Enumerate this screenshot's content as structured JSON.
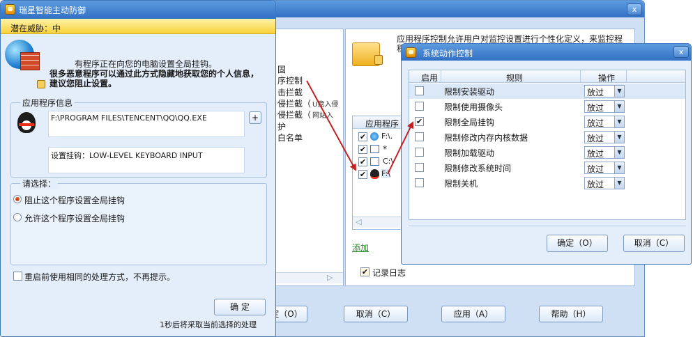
{
  "alert": {
    "title": "瑞星智能主动防御",
    "threat": "潜在威胁：中",
    "message1": "有程序正在向您的电脑设置全局挂钩。",
    "message2": "很多恶意程序可以通过此方式隐藏地获取您的个人信息，建议您阻止设置。",
    "info_label": "应用程序信息",
    "program_path": "F:\\PROGRAM FILES\\TENCENT\\QQ\\QQ.EXE",
    "plus": "+",
    "hook_info": "设置挂钩：LOW-LEVEL KEYBOARD INPUT",
    "choose_label": "请选择：",
    "options": [
      "阻止这个程序设置全局挂钩",
      "允许这个程序设置全局挂钩"
    ],
    "remember": "重启前使用相同的处理方式，不再提示。",
    "ok": "确 定",
    "countdown": "1秒后将采取当前选择的处理"
  },
  "background": {
    "close": "x",
    "tree_items": [
      "固",
      "序控制",
      "击拦截",
      "侵拦截（",
      "侵拦截（",
      "护",
      "白名单"
    ],
    "tree_suffix": [
      "U盘入侵",
      "网站入"
    ],
    "description": "应用程序控制允许用户对监控设置进行个性化定义，来监控程",
    "description2": "程",
    "list_header": "应用程序",
    "list_rows": [
      "F:\\.",
      "*",
      "C:\\",
      "F:\\"
    ],
    "add_link": "添加",
    "log_label": "记录日志",
    "buttons": [
      "定（O）",
      "取消（C）",
      "应用（A）",
      "帮助（H）"
    ]
  },
  "dialog": {
    "title": "系统动作控制",
    "close": "x",
    "columns": [
      "启用",
      "规则",
      "操作"
    ],
    "rules": [
      {
        "name": "限制安装驱动",
        "enabled": false,
        "action": "放过"
      },
      {
        "name": "限制使用摄像头",
        "enabled": false,
        "action": "放过"
      },
      {
        "name": "限制全局挂钩",
        "enabled": true,
        "action": "放过"
      },
      {
        "name": "限制修改内存内核数据",
        "enabled": false,
        "action": "放过"
      },
      {
        "name": "限制加载驱动",
        "enabled": false,
        "action": "放过"
      },
      {
        "name": "限制修改系统时间",
        "enabled": false,
        "action": "放过"
      },
      {
        "name": "限制关机",
        "enabled": false,
        "action": "放过"
      }
    ],
    "ok": "确定（O）",
    "cancel": "取消（C）"
  },
  "colors": {
    "accent": "#3270c4",
    "threat_bar": "#f7d23a",
    "arrow": "#c41f1f",
    "link": "#2a8a2a"
  }
}
